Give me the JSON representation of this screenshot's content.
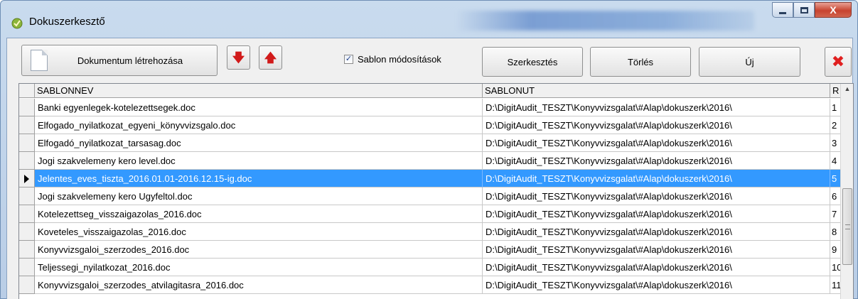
{
  "window": {
    "title": "Dokuszerkesztő",
    "close_symbol": "X",
    "minimize_symbol": "_",
    "maximize_symbol": "□"
  },
  "toolbar": {
    "create_document_label": "Dokumentum létrehozása",
    "move_down_symbol": "🡇",
    "move_up_symbol": "🡅",
    "template_changes_label": "Sablon módosítások",
    "template_changes_checked": true,
    "edit_label": "Szerkesztés",
    "delete_label": "Törlés",
    "new_label": "Új",
    "close_symbol": "✖"
  },
  "grid": {
    "columns": [
      "SABLONNEV",
      "SABLONUT",
      "R"
    ],
    "scroll_up_symbol": "▲",
    "rows": [
      {
        "name": "Banki egyenlegek-kotelezettsegek.doc",
        "path": "D:\\DigitAudit_TESZT\\Konyvvizsgalat\\#Alap\\dokuszerk\\2016\\",
        "r": "1"
      },
      {
        "name": "Elfogado_nyilatkozat_egyeni_könyvvizsgalo.doc",
        "path": "D:\\DigitAudit_TESZT\\Konyvvizsgalat\\#Alap\\dokuszerk\\2016\\",
        "r": "2"
      },
      {
        "name": "Elfogadó_nyilatkozat_tarsasag.doc",
        "path": "D:\\DigitAudit_TESZT\\Konyvvizsgalat\\#Alap\\dokuszerk\\2016\\",
        "r": "3"
      },
      {
        "name": "Jogi szakvelemeny kero level.doc",
        "path": "D:\\DigitAudit_TESZT\\Konyvvizsgalat\\#Alap\\dokuszerk\\2016\\",
        "r": "4"
      },
      {
        "name": "Jelentes_eves_tiszta_2016.01.01-2016.12.15-ig.doc",
        "path": "D:\\DigitAudit_TESZT\\Konyvvizsgalat\\#Alap\\dokuszerk\\2016\\",
        "r": "5",
        "selected": true
      },
      {
        "name": "Jogi szakvelemeny kero Ugyfeltol.doc",
        "path": "D:\\DigitAudit_TESZT\\Konyvvizsgalat\\#Alap\\dokuszerk\\2016\\",
        "r": "6"
      },
      {
        "name": "Kotelezettseg_visszaigazolas_2016.doc",
        "path": "D:\\DigitAudit_TESZT\\Konyvvizsgalat\\#Alap\\dokuszerk\\2016\\",
        "r": "7"
      },
      {
        "name": "Koveteles_visszaigazolas_2016.doc",
        "path": "D:\\DigitAudit_TESZT\\Konyvvizsgalat\\#Alap\\dokuszerk\\2016\\",
        "r": "8"
      },
      {
        "name": "Konyvvizsgaloi_szerzodes_2016.doc",
        "path": "D:\\DigitAudit_TESZT\\Konyvvizsgalat\\#Alap\\dokuszerk\\2016\\",
        "r": "9"
      },
      {
        "name": "Teljessegi_nyilatkozat_2016.doc",
        "path": "D:\\DigitAudit_TESZT\\Konyvvizsgalat\\#Alap\\dokuszerk\\2016\\",
        "r": "10"
      },
      {
        "name": "Konyvvizsgaloi_szerzodes_atvilagitasra_2016.doc",
        "path": "D:\\DigitAudit_TESZT\\Konyvvizsgalat\\#Alap\\dokuszerk\\2016\\",
        "r": "11"
      }
    ]
  },
  "colors": {
    "selection": "#3399ff",
    "arrow_red": "#d11a1a",
    "close_red": "#e02020"
  }
}
